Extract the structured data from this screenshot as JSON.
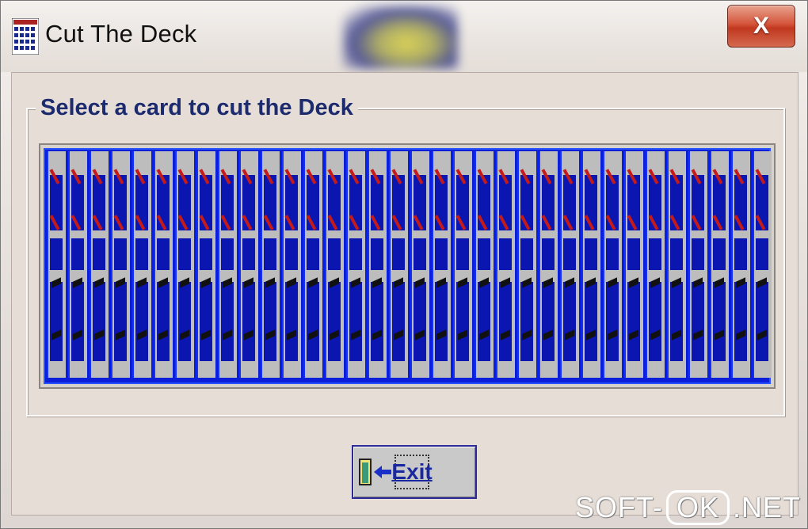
{
  "window": {
    "title": "Cut The Deck",
    "close_label": "X"
  },
  "group": {
    "label": "Select a card to cut the Deck"
  },
  "deck": {
    "card_count": 34,
    "card_back_colors": {
      "blue": "#0b16b0",
      "grey": "#bdbdbd",
      "red": "#c41a1a",
      "black": "#111111"
    }
  },
  "exit_button": {
    "label": "Exit",
    "icon": "exit-door-icon"
  },
  "watermark": {
    "left": "SOFT-",
    "ok": "OK",
    "right": ".NET"
  }
}
